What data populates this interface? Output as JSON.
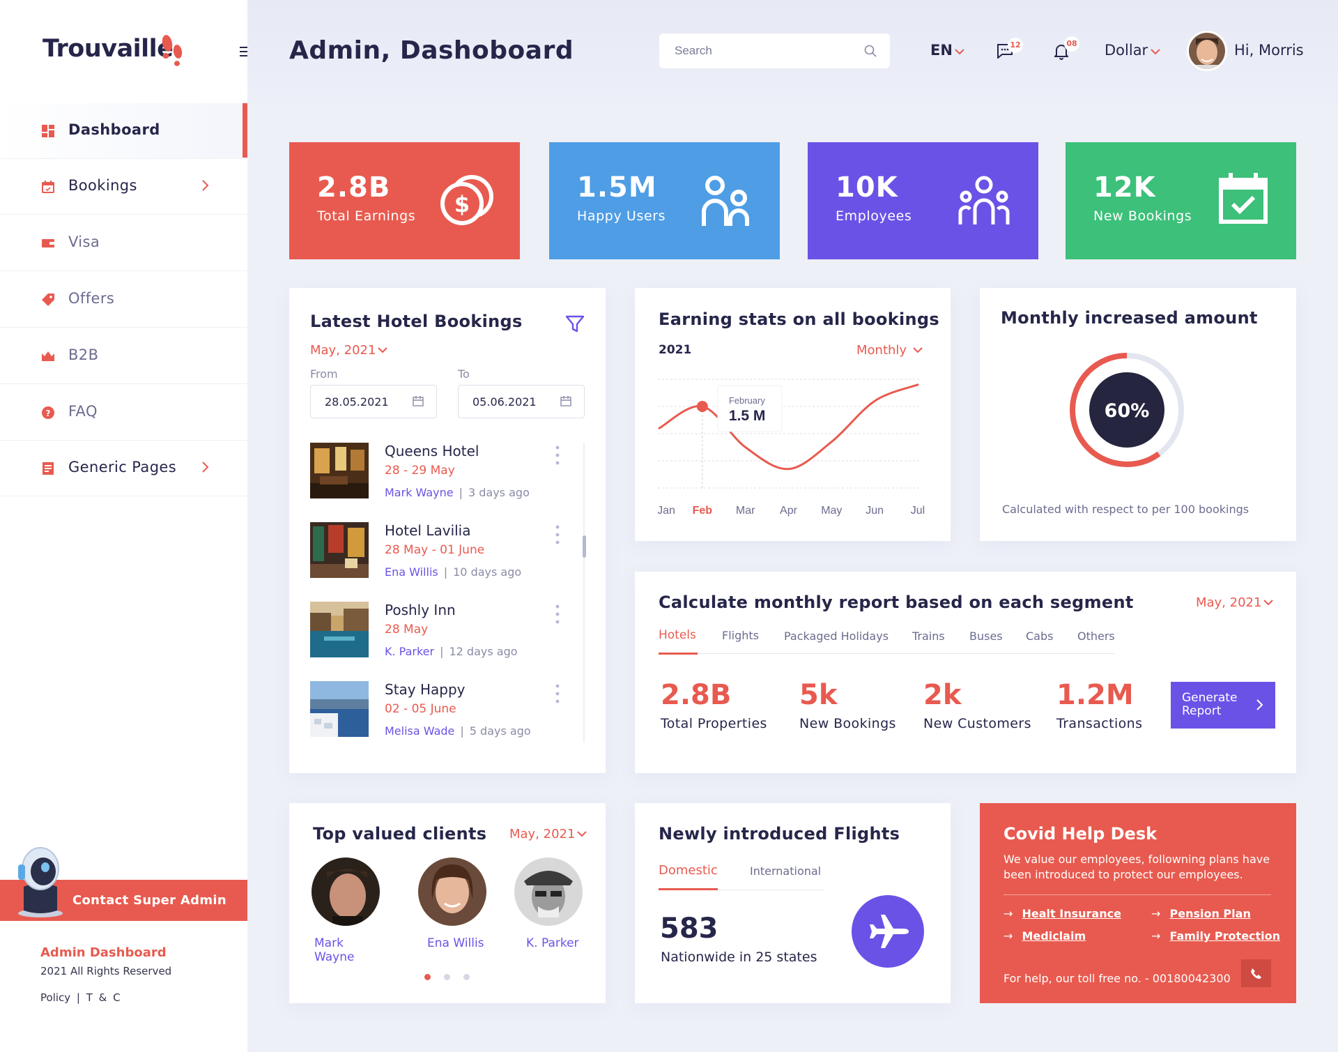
{
  "brand": {
    "name": "Trouvaille"
  },
  "sidebar": {
    "items": [
      {
        "label": "Dashboard",
        "icon": "dashboard-icon"
      },
      {
        "label": "Bookings",
        "icon": "calendar-icon"
      },
      {
        "label": "Visa",
        "icon": "wallet-icon"
      },
      {
        "label": "Offers",
        "icon": "tag-icon"
      },
      {
        "label": "B2B",
        "icon": "crown-icon"
      },
      {
        "label": "FAQ",
        "icon": "help-icon"
      },
      {
        "label": "Generic Pages",
        "icon": "document-icon"
      }
    ],
    "contact_label": "Contact Super Admin",
    "footer_title": "Admin Dashboard",
    "footer_rights": "2021 All Rights Reserved",
    "footer_links": "Policy | T & C"
  },
  "header": {
    "title": "Admin, Dashoboard",
    "search_placeholder": "Search",
    "language": "EN",
    "chat_count": "12",
    "notification_count": "08",
    "currency": "Dollar",
    "greeting": "Hi, Morris"
  },
  "stats": [
    {
      "value": "2.8B",
      "label": "Total Earnings",
      "color": "#e85a4f"
    },
    {
      "value": "1.5M",
      "label": "Happy Users",
      "color": "#4e9de5"
    },
    {
      "value": "10K",
      "label": "Employees",
      "color": "#6b52e6"
    },
    {
      "value": "12K",
      "label": "New Bookings",
      "color": "#3cc07a"
    }
  ],
  "bookings": {
    "title": "Latest Hotel Bookings",
    "period": "May, 2021",
    "from_label": "From",
    "to_label": "To",
    "from_date": "28.05.2021",
    "to_date": "05.06.2021",
    "items": [
      {
        "name": "Queens Hotel",
        "dates": "28 - 29 May",
        "person": "Mark Wayne",
        "ago": "3 days ago"
      },
      {
        "name": "Hotel Lavilia",
        "dates": "28 May - 01 June",
        "person": "Ena Willis",
        "ago": "10 days ago"
      },
      {
        "name": "Poshly Inn",
        "dates": "28 May",
        "person": "K. Parker",
        "ago": "12 days ago"
      },
      {
        "name": "Stay Happy",
        "dates": "02 - 05 June",
        "person": "Melisa Wade",
        "ago": "5 days ago"
      }
    ]
  },
  "earnings": {
    "title": "Earning stats on all bookings",
    "year": "2021",
    "period": "Monthly",
    "tooltip_month": "February",
    "tooltip_value": "1.5 M"
  },
  "chart_data": {
    "type": "line",
    "categories": [
      "Jan",
      "Feb",
      "Mar",
      "Apr",
      "May",
      "Jun",
      "Jul"
    ],
    "highlight": "Feb",
    "series": [
      {
        "values": [
          1.1,
          1.5,
          0.75,
          0.35,
          0.85,
          1.6,
          1.9
        ]
      }
    ]
  },
  "monthly": {
    "title": "Monthly increased amount",
    "percent_label": "60%",
    "percent": 0.6,
    "note": "Calculated with respect to per 100 bookings"
  },
  "segment": {
    "title": "Calculate monthly report based on each segment",
    "period": "May, 2021",
    "tabs": [
      "Hotels",
      "Flights",
      "Packaged Holidays",
      "Trains",
      "Buses",
      "Cabs",
      "Others"
    ],
    "metrics": [
      {
        "value": "2.8B",
        "label": "Total Properties"
      },
      {
        "value": "5k",
        "label": "New Bookings"
      },
      {
        "value": "2k",
        "label": "New Customers"
      },
      {
        "value": "1.2M",
        "label": "Transactions"
      }
    ],
    "button_label": "Generate Report"
  },
  "clients": {
    "title": "Top valued clients",
    "period": "May, 2021",
    "items": [
      {
        "name": "Mark Wayne"
      },
      {
        "name": "Ena Willis"
      },
      {
        "name": "K. Parker"
      }
    ]
  },
  "flights": {
    "title": "Newly introduced Flights",
    "tab_domestic": "Domestic",
    "tab_international": "International",
    "count": "583",
    "caption": "Nationwide in 25 states"
  },
  "covid": {
    "title": "Covid Help Desk",
    "text": "We value our employees, followning plans have been introduced to protect our employees.",
    "links": [
      "Healt Insurance",
      "Pension Plan",
      "Mediclaim",
      "Family Protection"
    ],
    "helpline": "For help, our toll free no. - 00180042300"
  }
}
